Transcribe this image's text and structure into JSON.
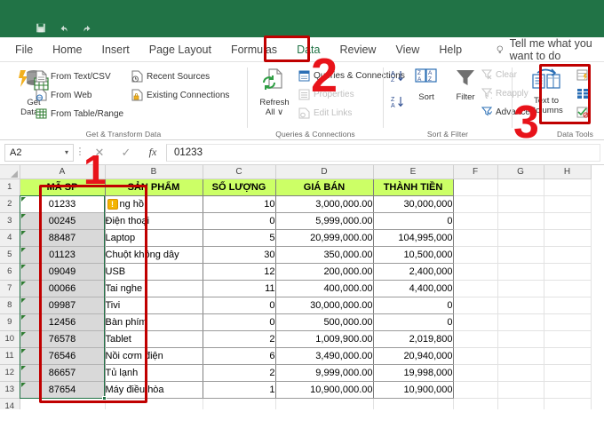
{
  "app": {
    "quick_access_icons": [
      "save-icon",
      "undo-icon",
      "redo-icon"
    ]
  },
  "ribbon": {
    "tabs": [
      {
        "label": "File",
        "active": false
      },
      {
        "label": "Home",
        "active": false
      },
      {
        "label": "Insert",
        "active": false
      },
      {
        "label": "Page Layout",
        "active": false
      },
      {
        "label": "Formulas",
        "active": false
      },
      {
        "label": "Data",
        "active": true
      },
      {
        "label": "Review",
        "active": false
      },
      {
        "label": "View",
        "active": false
      },
      {
        "label": "Help",
        "active": false
      }
    ],
    "tell_me": "Tell me what you want to do",
    "groups": [
      {
        "title": "Get & Transform Data",
        "big_button": {
          "line1": "Get",
          "line2": "Data ∨",
          "icon": "get-data-icon"
        },
        "items": [
          {
            "label": "From Text/CSV",
            "icon": "text-csv-icon",
            "disabled": false
          },
          {
            "label": "From Web",
            "icon": "from-web-icon",
            "disabled": false
          },
          {
            "label": "From Table/Range",
            "icon": "from-table-icon",
            "disabled": false
          },
          {
            "label": "Recent Sources",
            "icon": "recent-sources-icon",
            "disabled": false
          },
          {
            "label": "Existing Connections",
            "icon": "existing-connections-icon",
            "disabled": false
          }
        ]
      },
      {
        "title": "Queries & Connections",
        "big_button": {
          "line1": "Refresh",
          "line2": "All ∨",
          "icon": "refresh-all-icon"
        },
        "items": [
          {
            "label": "Queries & Connections",
            "icon": "queries-connections-icon",
            "disabled": false
          },
          {
            "label": "Properties",
            "icon": "properties-icon",
            "disabled": true
          },
          {
            "label": "Edit Links",
            "icon": "edit-links-icon",
            "disabled": true
          }
        ]
      },
      {
        "title": "Sort & Filter",
        "big_button": {
          "line1": "",
          "line2": "Sort",
          "icon": "sort-icon"
        },
        "items": [
          {
            "label": "Clear",
            "icon": "clear-filter-icon",
            "disabled": true
          },
          {
            "label": "Reapply",
            "icon": "reapply-icon",
            "disabled": true
          },
          {
            "label": "Advanced",
            "icon": "advanced-filter-icon",
            "disabled": false
          }
        ],
        "extra": [
          {
            "label": "Filter",
            "icon": "filter-icon"
          },
          {
            "label": "sort-az-icon",
            "icon": "sort-az-icon"
          },
          {
            "label": "sort-za-icon",
            "icon": "sort-za-icon"
          }
        ]
      },
      {
        "title": "Data Tools",
        "big_button": {
          "line1": "Text to",
          "line2": "Columns",
          "icon": "text-to-columns-icon"
        },
        "items": [
          {
            "label": "flash-fill-icon",
            "icon": "flash-fill-icon",
            "disabled": false
          },
          {
            "label": "remove-duplicates-icon",
            "icon": "remove-duplicates-icon",
            "disabled": false
          },
          {
            "label": "data-validation-icon",
            "icon": "data-validation-icon",
            "disabled": false
          }
        ]
      }
    ]
  },
  "formula_bar": {
    "name_box": "A2",
    "dropdown_icon": "chevron-down-icon",
    "cancel_icon": "✕",
    "enter_icon": "✓",
    "fx_icon": "fx",
    "value": "01233"
  },
  "sheet": {
    "column_headers": [
      "A",
      "B",
      "C",
      "D",
      "E",
      "F",
      "G",
      "H"
    ],
    "row_numbers": [
      "1",
      "2",
      "3",
      "4",
      "5",
      "6",
      "7",
      "8",
      "9",
      "10",
      "11",
      "12",
      "13",
      "14"
    ],
    "table_headers": [
      "MÃ SP",
      "SẢN PHẨM",
      "SỐ LƯỢNG",
      "GIÁ BÁN",
      "THÀNH TIỀN"
    ],
    "rows": [
      {
        "row": "2",
        "code": "01233",
        "product": "ng hồ",
        "qty": "10",
        "price": "3,000,000.00",
        "total": "30,000,000",
        "selected_cell": true,
        "warn_badge": true
      },
      {
        "row": "3",
        "code": "00245",
        "product": "Điện thoại",
        "qty": "0",
        "price": "5,999,000.00",
        "total": "0",
        "selected_cell": false,
        "warn_badge": false
      },
      {
        "row": "4",
        "code": "88487",
        "product": "Laptop",
        "qty": "5",
        "price": "20,999,000.00",
        "total": "104,995,000",
        "selected_cell": false,
        "warn_badge": false
      },
      {
        "row": "5",
        "code": "01123",
        "product": "Chuột không dây",
        "qty": "30",
        "price": "350,000.00",
        "total": "10,500,000",
        "selected_cell": false,
        "warn_badge": false
      },
      {
        "row": "6",
        "code": "09049",
        "product": "USB",
        "qty": "12",
        "price": "200,000.00",
        "total": "2,400,000",
        "selected_cell": false,
        "warn_badge": false
      },
      {
        "row": "7",
        "code": "00066",
        "product": "Tai nghe",
        "qty": "11",
        "price": "400,000.00",
        "total": "4,400,000",
        "selected_cell": false,
        "warn_badge": false
      },
      {
        "row": "8",
        "code": "09987",
        "product": "Tivi",
        "qty": "0",
        "price": "30,000,000.00",
        "total": "0",
        "selected_cell": false,
        "warn_badge": false
      },
      {
        "row": "9",
        "code": "12456",
        "product": "Bàn phím",
        "qty": "0",
        "price": "500,000.00",
        "total": "0",
        "selected_cell": false,
        "warn_badge": false
      },
      {
        "row": "10",
        "code": "76578",
        "product": "Tablet",
        "qty": "2",
        "price": "1,009,900.00",
        "total": "2,019,800",
        "selected_cell": false,
        "warn_badge": false
      },
      {
        "row": "11",
        "code": "76546",
        "product": "Nồi cơm điện",
        "qty": "6",
        "price": "3,490,000.00",
        "total": "20,940,000",
        "selected_cell": false,
        "warn_badge": false
      },
      {
        "row": "12",
        "code": "86657",
        "product": "Tủ lạnh",
        "qty": "2",
        "price": "9,999,000.00",
        "total": "19,998,000",
        "selected_cell": false,
        "warn_badge": false
      },
      {
        "row": "13",
        "code": "87654",
        "product": "Máy điều hòa",
        "qty": "1",
        "price": "10,900,000.00",
        "total": "10,900,000",
        "selected_cell": false,
        "warn_badge": false
      }
    ]
  },
  "annotations": [
    {
      "number": "1",
      "target": "selected-column-a-range"
    },
    {
      "number": "2",
      "target": "data-tab"
    },
    {
      "number": "3",
      "target": "text-to-columns-button"
    }
  ],
  "colors": {
    "excel_green": "#217346",
    "header_fill": "#ccff66",
    "annotation_red": "#e8131a",
    "annotation_box": "#c00000",
    "selection_grey": "#d9d9d9"
  }
}
